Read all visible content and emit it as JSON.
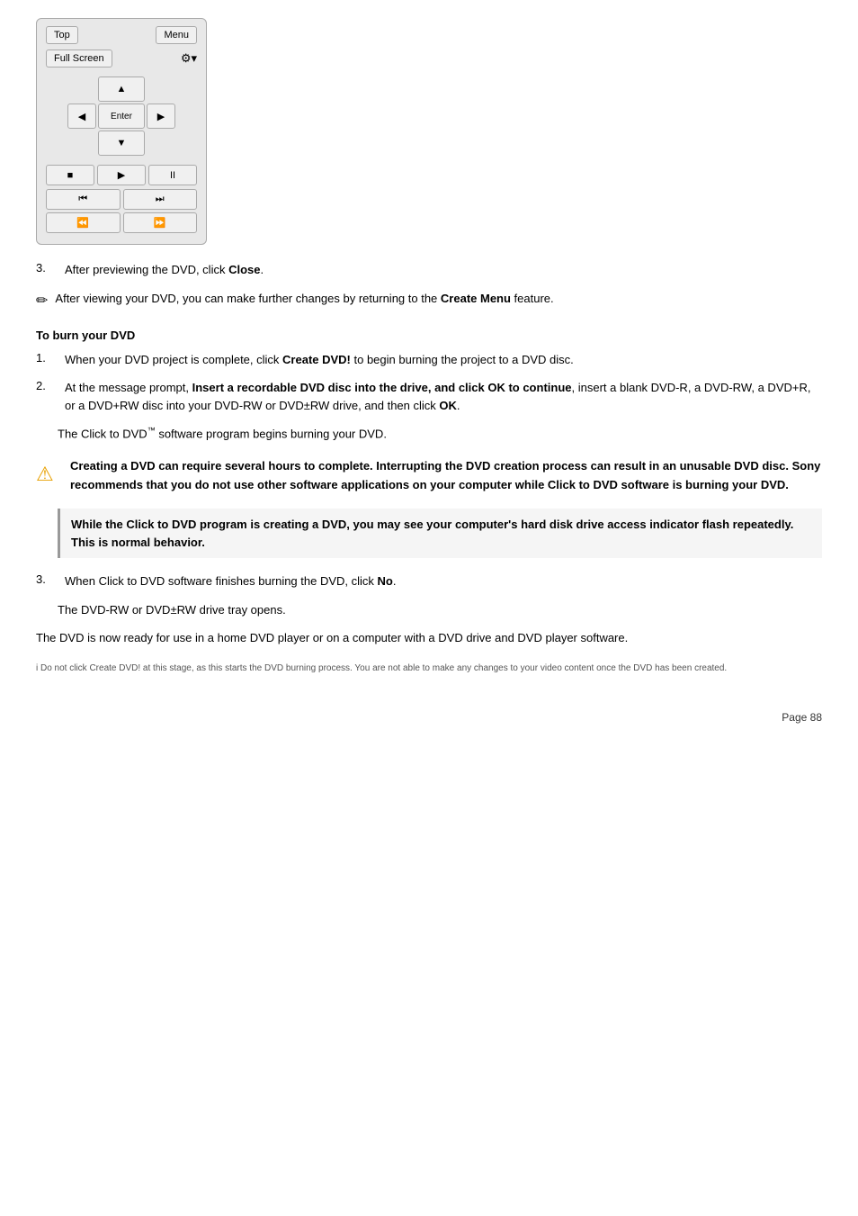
{
  "remote": {
    "top_label": "Top",
    "menu_label": "Menu",
    "fullscreen_label": "Full Screen",
    "enter_label": "Enter",
    "up_icon": "▲",
    "down_icon": "▼",
    "left_icon": "◀",
    "right_icon": "▶",
    "stop_icon": "■",
    "play_icon": "▶",
    "pause_icon": "⏸",
    "prev_icon": "⏮",
    "next_icon": "⏭",
    "rew_icon": "⏪",
    "fwd_icon": "⏩",
    "settings_icon": "⚙"
  },
  "steps": {
    "step3_text": "After previewing the DVD, click ",
    "step3_bold": "Close",
    "step3_period": ".",
    "note_text": "After viewing your DVD, you can make further changes by returning to the ",
    "note_bold": "Create Menu",
    "note_suffix": " feature.",
    "section_heading": "To burn your DVD",
    "burn_step1_text": "When your DVD project is complete, click ",
    "burn_step1_bold": "Create DVD!",
    "burn_step1_suffix": " to begin burning the project to a DVD disc.",
    "burn_step2_text": "At the message prompt, ",
    "burn_step2_bold": "Insert a recordable DVD disc into the drive, and click OK to continue",
    "burn_step2_suffix": ", insert a blank DVD-R, a DVD-RW, a DVD+R, or a DVD+RW disc into your DVD-RW or DVD±RW drive, and then click ",
    "burn_step2_ok": "OK",
    "burn_step2_period": ".",
    "click_to_dvd_text": "The Click to DVD",
    "click_to_dvd_tm": "™",
    "click_to_dvd_suffix": " software program begins burning your DVD.",
    "warning_text": "Creating a DVD can require several hours to complete. Interrupting the DVD creation process can result in an unusable DVD disc. Sony recommends that you do not use other software applications on your computer while Click to DVD software is burning your DVD.",
    "info_bold": "While the Click to DVD program is creating a DVD, you may see your computer's hard disk drive access indicator flash repeatedly. This is normal behavior.",
    "burn_step3_text": "When Click to DVD software finishes burning the DVD, click ",
    "burn_step3_bold": "No",
    "burn_step3_period": ".",
    "tray_text": "The DVD-RW or DVD±RW drive tray opens.",
    "ready_text": "The DVD is now ready for use in a home DVD player or on a computer with a DVD drive and DVD player software.",
    "footnote_text": "i Do not click Create DVD! at this stage, as this starts the DVD burning process. You are not able to make any changes to your video content once the DVD has been created.",
    "page_number": "Page 88"
  }
}
